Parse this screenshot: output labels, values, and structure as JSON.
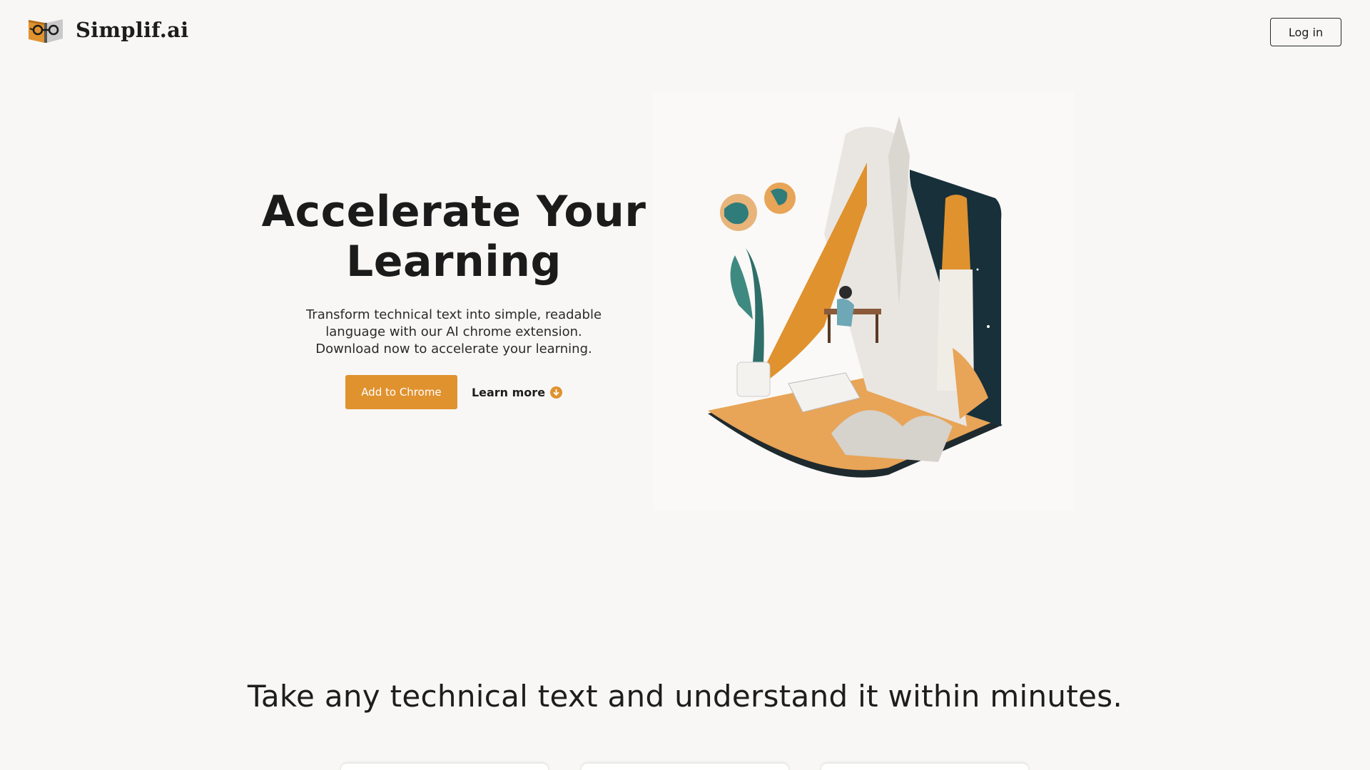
{
  "header": {
    "brand_name": "Simplif.ai",
    "logo_icon": "book-glasses-icon",
    "login_label": "Log in"
  },
  "hero": {
    "title_line1": "Accelerate Your",
    "title_line2": "Learning",
    "subtitle": "Transform technical text into simple, readable language with our AI chrome extension. Download now to accelerate your learning.",
    "cta_label": "Add to Chrome",
    "learn_more_label": "Learn more",
    "learn_more_icon": "arrow-down-circle-icon"
  },
  "tagline": "Take any technical text and understand it within minutes.",
  "colors": {
    "accent": "#e0922f",
    "background": "#f8f7f6",
    "text": "#1b1b1b"
  }
}
